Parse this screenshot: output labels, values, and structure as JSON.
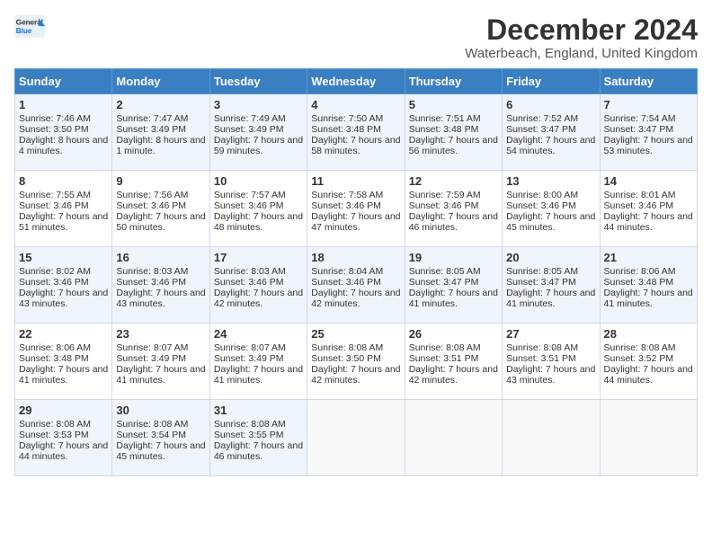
{
  "header": {
    "logo_general": "General",
    "logo_blue": "Blue",
    "month_title": "December 2024",
    "location": "Waterbeach, England, United Kingdom"
  },
  "calendar": {
    "days_of_week": [
      "Sunday",
      "Monday",
      "Tuesday",
      "Wednesday",
      "Thursday",
      "Friday",
      "Saturday"
    ],
    "weeks": [
      [
        {
          "day": "1",
          "sunrise": "Sunrise: 7:46 AM",
          "sunset": "Sunset: 3:50 PM",
          "daylight": "Daylight: 8 hours and 4 minutes."
        },
        {
          "day": "2",
          "sunrise": "Sunrise: 7:47 AM",
          "sunset": "Sunset: 3:49 PM",
          "daylight": "Daylight: 8 hours and 1 minute."
        },
        {
          "day": "3",
          "sunrise": "Sunrise: 7:49 AM",
          "sunset": "Sunset: 3:49 PM",
          "daylight": "Daylight: 7 hours and 59 minutes."
        },
        {
          "day": "4",
          "sunrise": "Sunrise: 7:50 AM",
          "sunset": "Sunset: 3:48 PM",
          "daylight": "Daylight: 7 hours and 58 minutes."
        },
        {
          "day": "5",
          "sunrise": "Sunrise: 7:51 AM",
          "sunset": "Sunset: 3:48 PM",
          "daylight": "Daylight: 7 hours and 56 minutes."
        },
        {
          "day": "6",
          "sunrise": "Sunrise: 7:52 AM",
          "sunset": "Sunset: 3:47 PM",
          "daylight": "Daylight: 7 hours and 54 minutes."
        },
        {
          "day": "7",
          "sunrise": "Sunrise: 7:54 AM",
          "sunset": "Sunset: 3:47 PM",
          "daylight": "Daylight: 7 hours and 53 minutes."
        }
      ],
      [
        {
          "day": "8",
          "sunrise": "Sunrise: 7:55 AM",
          "sunset": "Sunset: 3:46 PM",
          "daylight": "Daylight: 7 hours and 51 minutes."
        },
        {
          "day": "9",
          "sunrise": "Sunrise: 7:56 AM",
          "sunset": "Sunset: 3:46 PM",
          "daylight": "Daylight: 7 hours and 50 minutes."
        },
        {
          "day": "10",
          "sunrise": "Sunrise: 7:57 AM",
          "sunset": "Sunset: 3:46 PM",
          "daylight": "Daylight: 7 hours and 48 minutes."
        },
        {
          "day": "11",
          "sunrise": "Sunrise: 7:58 AM",
          "sunset": "Sunset: 3:46 PM",
          "daylight": "Daylight: 7 hours and 47 minutes."
        },
        {
          "day": "12",
          "sunrise": "Sunrise: 7:59 AM",
          "sunset": "Sunset: 3:46 PM",
          "daylight": "Daylight: 7 hours and 46 minutes."
        },
        {
          "day": "13",
          "sunrise": "Sunrise: 8:00 AM",
          "sunset": "Sunset: 3:46 PM",
          "daylight": "Daylight: 7 hours and 45 minutes."
        },
        {
          "day": "14",
          "sunrise": "Sunrise: 8:01 AM",
          "sunset": "Sunset: 3:46 PM",
          "daylight": "Daylight: 7 hours and 44 minutes."
        }
      ],
      [
        {
          "day": "15",
          "sunrise": "Sunrise: 8:02 AM",
          "sunset": "Sunset: 3:46 PM",
          "daylight": "Daylight: 7 hours and 43 minutes."
        },
        {
          "day": "16",
          "sunrise": "Sunrise: 8:03 AM",
          "sunset": "Sunset: 3:46 PM",
          "daylight": "Daylight: 7 hours and 43 minutes."
        },
        {
          "day": "17",
          "sunrise": "Sunrise: 8:03 AM",
          "sunset": "Sunset: 3:46 PM",
          "daylight": "Daylight: 7 hours and 42 minutes."
        },
        {
          "day": "18",
          "sunrise": "Sunrise: 8:04 AM",
          "sunset": "Sunset: 3:46 PM",
          "daylight": "Daylight: 7 hours and 42 minutes."
        },
        {
          "day": "19",
          "sunrise": "Sunrise: 8:05 AM",
          "sunset": "Sunset: 3:47 PM",
          "daylight": "Daylight: 7 hours and 41 minutes."
        },
        {
          "day": "20",
          "sunrise": "Sunrise: 8:05 AM",
          "sunset": "Sunset: 3:47 PM",
          "daylight": "Daylight: 7 hours and 41 minutes."
        },
        {
          "day": "21",
          "sunrise": "Sunrise: 8:06 AM",
          "sunset": "Sunset: 3:48 PM",
          "daylight": "Daylight: 7 hours and 41 minutes."
        }
      ],
      [
        {
          "day": "22",
          "sunrise": "Sunrise: 8:06 AM",
          "sunset": "Sunset: 3:48 PM",
          "daylight": "Daylight: 7 hours and 41 minutes."
        },
        {
          "day": "23",
          "sunrise": "Sunrise: 8:07 AM",
          "sunset": "Sunset: 3:49 PM",
          "daylight": "Daylight: 7 hours and 41 minutes."
        },
        {
          "day": "24",
          "sunrise": "Sunrise: 8:07 AM",
          "sunset": "Sunset: 3:49 PM",
          "daylight": "Daylight: 7 hours and 41 minutes."
        },
        {
          "day": "25",
          "sunrise": "Sunrise: 8:08 AM",
          "sunset": "Sunset: 3:50 PM",
          "daylight": "Daylight: 7 hours and 42 minutes."
        },
        {
          "day": "26",
          "sunrise": "Sunrise: 8:08 AM",
          "sunset": "Sunset: 3:51 PM",
          "daylight": "Daylight: 7 hours and 42 minutes."
        },
        {
          "day": "27",
          "sunrise": "Sunrise: 8:08 AM",
          "sunset": "Sunset: 3:51 PM",
          "daylight": "Daylight: 7 hours and 43 minutes."
        },
        {
          "day": "28",
          "sunrise": "Sunrise: 8:08 AM",
          "sunset": "Sunset: 3:52 PM",
          "daylight": "Daylight: 7 hours and 44 minutes."
        }
      ],
      [
        {
          "day": "29",
          "sunrise": "Sunrise: 8:08 AM",
          "sunset": "Sunset: 3:53 PM",
          "daylight": "Daylight: 7 hours and 44 minutes."
        },
        {
          "day": "30",
          "sunrise": "Sunrise: 8:08 AM",
          "sunset": "Sunset: 3:54 PM",
          "daylight": "Daylight: 7 hours and 45 minutes."
        },
        {
          "day": "31",
          "sunrise": "Sunrise: 8:08 AM",
          "sunset": "Sunset: 3:55 PM",
          "daylight": "Daylight: 7 hours and 46 minutes."
        },
        null,
        null,
        null,
        null
      ]
    ]
  }
}
